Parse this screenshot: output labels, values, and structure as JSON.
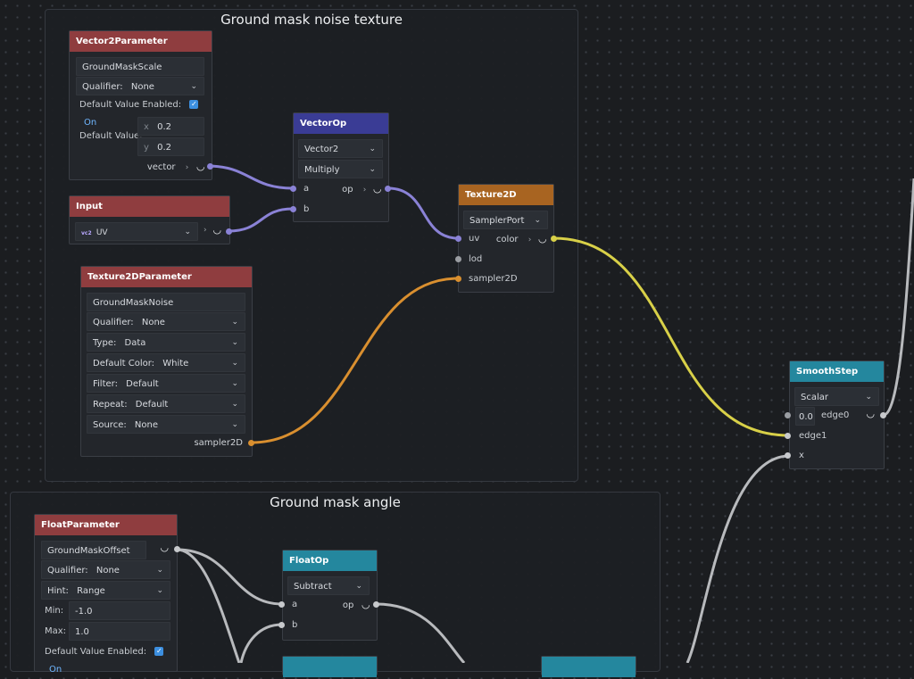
{
  "groups": {
    "noise_title": "Ground mask noise texture",
    "angle_title": "Ground mask angle"
  },
  "vector2param": {
    "title": "Vector2Parameter",
    "name": "GroundMaskScale",
    "qualifier_label": "Qualifier:",
    "qualifier_value": "None",
    "default_enabled_label": "Default Value Enabled:",
    "on_label": "On",
    "default_value_label": "Default Value:",
    "x_label": "x",
    "x_value": "0.2",
    "y_label": "y",
    "y_value": "0.2",
    "output_label": "vector"
  },
  "input_node": {
    "title": "Input",
    "badge": "vc2",
    "value": "UV"
  },
  "vectorop": {
    "title": "VectorOp",
    "type_value": "Vector2",
    "op_value": "Multiply",
    "a_label": "a",
    "b_label": "b",
    "op_label": "op"
  },
  "texture2d": {
    "title": "Texture2D",
    "sampler_value": "SamplerPort",
    "uv_label": "uv",
    "lod_label": "lod",
    "sampler_label": "sampler2D",
    "color_label": "color"
  },
  "tex2dparam": {
    "title": "Texture2DParameter",
    "name": "GroundMaskNoise",
    "qualifier_label": "Qualifier:",
    "qualifier_value": "None",
    "type_label": "Type:",
    "type_value": "Data",
    "default_color_label": "Default Color:",
    "default_color_value": "White",
    "filter_label": "Filter:",
    "filter_value": "Default",
    "repeat_label": "Repeat:",
    "repeat_value": "Default",
    "source_label": "Source:",
    "source_value": "None",
    "output_label": "sampler2D"
  },
  "smoothstep": {
    "title": "SmoothStep",
    "type_value": "Scalar",
    "edge0_value": "0.0",
    "edge0_label": "edge0",
    "edge1_label": "edge1",
    "x_label": "x"
  },
  "floatparam": {
    "title": "FloatParameter",
    "name": "GroundMaskOffset",
    "qualifier_label": "Qualifier:",
    "qualifier_value": "None",
    "hint_label": "Hint:",
    "hint_value": "Range",
    "min_label": "Min:",
    "min_value": "-1.0",
    "max_label": "Max:",
    "max_value": "1.0",
    "default_enabled_label": "Default Value Enabled:",
    "on_label": "On"
  },
  "floatop": {
    "title": "FloatOp",
    "op_value": "Subtract",
    "a_label": "a",
    "b_label": "b",
    "op_label": "op"
  },
  "colors": {
    "background": "#1b1d20",
    "header_red": "#8f3d3f",
    "header_blue": "#3a3c95",
    "header_orange": "#a86421",
    "header_teal": "#24879e",
    "wire_purple": "#8a82d6",
    "wire_orange": "#d98f2f",
    "wire_yellow": "#d8d048",
    "wire_gray": "#b8babd"
  }
}
